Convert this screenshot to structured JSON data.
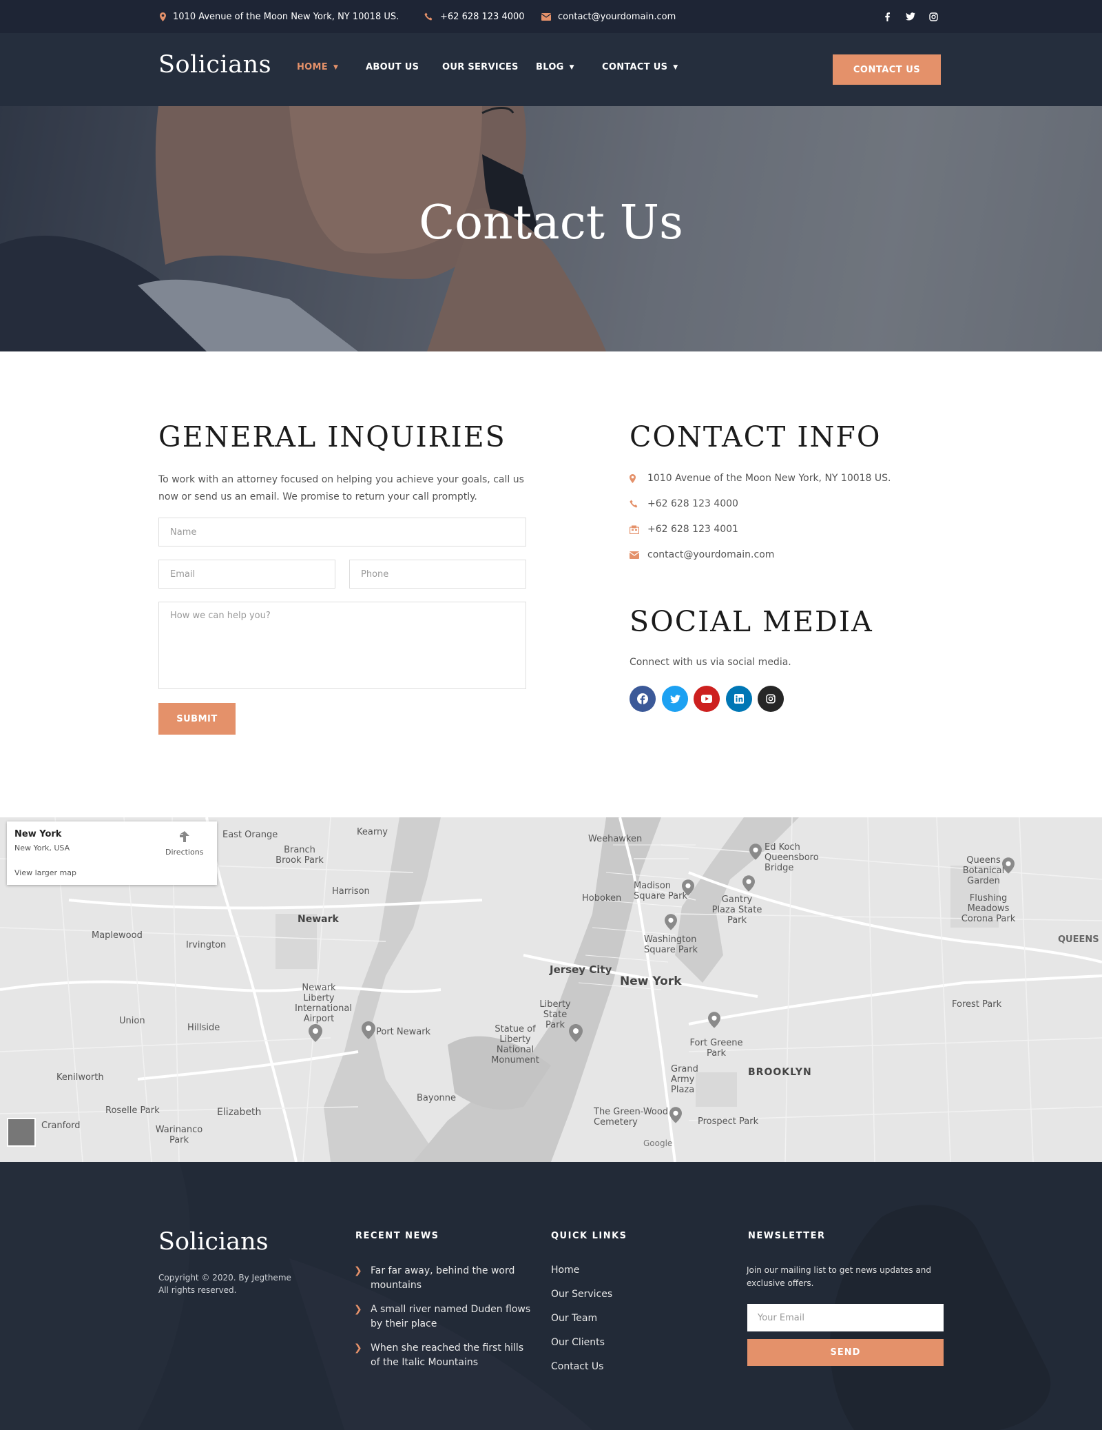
{
  "colors": {
    "accent": "#e4916a",
    "topbar": "#1e2535",
    "header": "#252e3d",
    "footer": "#262d3a"
  },
  "topbar": {
    "address": "1010 Avenue of the Moon New York, NY 10018 US.",
    "phone": "+62 628 123 4000",
    "email": "contact@yourdomain.com",
    "social_icons": [
      "facebook-icon",
      "twitter-icon",
      "instagram-icon"
    ]
  },
  "header": {
    "logo": "Solicians",
    "nav": [
      {
        "label": "HOME",
        "active": true,
        "dropdown": true
      },
      {
        "label": "ABOUT US",
        "active": false,
        "dropdown": false
      },
      {
        "label": "OUR SERVICES",
        "active": false,
        "dropdown": false
      },
      {
        "label": "BLOG",
        "active": false,
        "dropdown": true
      },
      {
        "label": "CONTACT US",
        "active": false,
        "dropdown": true
      }
    ],
    "cta": "CONTACT US"
  },
  "hero": {
    "title": "Contact Us"
  },
  "inquiries": {
    "heading": "GENERAL INQUIRIES",
    "intro": "To work with an attorney focused on helping you achieve your goals, call us now or send us an email. We promise to return your call promptly.",
    "name_placeholder": "Name",
    "email_placeholder": "Email",
    "phone_placeholder": "Phone",
    "message_placeholder": "How we can help you?",
    "submit": "SUBMIT"
  },
  "contact_info": {
    "heading": "CONTACT INFO",
    "address": "1010 Avenue of the Moon New York, NY 10018 US.",
    "phone": "+62 628 123 4000",
    "fax": "+62 628 123 4001",
    "email": "contact@yourdomain.com"
  },
  "social": {
    "heading": "SOCIAL MEDIA",
    "text": "Connect with us via social media.",
    "icons": [
      {
        "name": "facebook-icon",
        "color": "#3b5998"
      },
      {
        "name": "twitter-icon",
        "color": "#1da1f2"
      },
      {
        "name": "youtube-icon",
        "color": "#cd201f"
      },
      {
        "name": "linkedin-icon",
        "color": "#0077b5"
      },
      {
        "name": "instagram-icon",
        "color": "#262626"
      }
    ]
  },
  "map": {
    "card_title": "New York",
    "card_subtitle": "New York, USA",
    "directions": "Directions",
    "larger_map": "View larger map",
    "labels": {
      "new_york": "New York",
      "brooklyn": "BROOKLYN",
      "jersey_city": "Jersey City",
      "newark": "Newark",
      "hoboken": "Hoboken",
      "weehawken": "Weehawken",
      "east_orange": "East Orange",
      "kearny": "Kearny",
      "harrison": "Harrison",
      "irvington": "Irvington",
      "maplewood": "Maplewood",
      "union": "Union",
      "hillside": "Hillside",
      "elizabeth": "Elizabeth",
      "kenilworth": "Kenilworth",
      "roselle_park": "Roselle Park",
      "cranford": "Cranford",
      "bayonne": "Bayonne",
      "port_newark": "Port Newark",
      "forest_park": "Forest Park",
      "prospect_park": "Prospect Park",
      "corona_park": "Flushing Meadows Corona Park",
      "queens": "QUEENS",
      "queens_garden": "Queens Botanical Garden",
      "queensboro": "Ed Koch Queensboro Bridge",
      "madison": "Madison Square Park",
      "washington": "Washington Square Park",
      "gantry": "Gantry Plaza State Park",
      "liberty_park": "Liberty State Park",
      "statue": "Statue of Liberty National Monument",
      "airport": "Newark Liberty International Airport",
      "fort_greene": "Fort Greene Park",
      "army_plaza": "Grand Army Plaza",
      "green_wood": "The Green-Wood Cemetery",
      "branch_brook": "Branch Brook Park",
      "warinanco": "Warinanco Park",
      "google": "Google"
    }
  },
  "footer": {
    "logo": "Solicians",
    "copyright": "Copyright © 2020. By Jegtheme",
    "rights": "All rights reserved.",
    "news_heading": "RECENT NEWS",
    "news": [
      "Far far away, behind the word mountains",
      "A small river named Duden flows by their place",
      "When she reached the first hills of the Italic Mountains"
    ],
    "links_heading": "QUICK LINKS",
    "links": [
      "Home",
      "Our Services",
      "Our Team",
      "Our Clients",
      "Contact Us"
    ],
    "newsletter_heading": "NEWSLETTER",
    "newsletter_text": "Join our mailing list to get news updates and exclusive offers.",
    "email_placeholder": "Your Email",
    "send": "SEND"
  }
}
